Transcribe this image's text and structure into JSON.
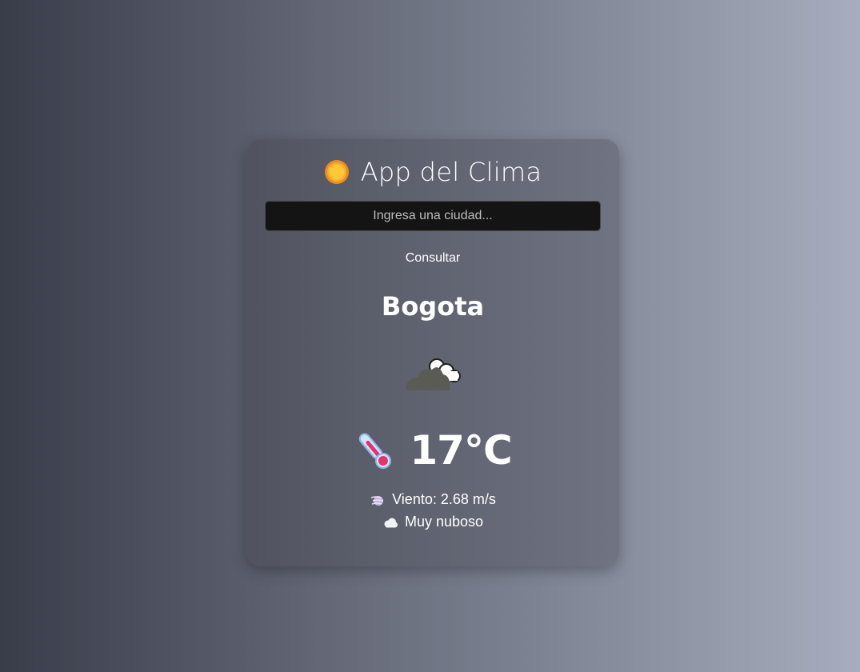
{
  "app": {
    "title": "App del Clima",
    "title_icon": "sun-icon"
  },
  "search": {
    "placeholder": "Ingresa una ciudad...",
    "value": "",
    "button_label": "Consultar"
  },
  "weather": {
    "city": "Bogota",
    "condition_icon": "cloud-icon",
    "temperature_icon": "thermometer-icon",
    "temperature": "17°C",
    "wind_icon": "wind-icon",
    "wind": "Viento: 2.68 m/s",
    "description_icon": "small-cloud-icon",
    "description": "Muy nuboso"
  },
  "colors": {
    "background_start": "#393d4a",
    "background_end": "#a7adbe",
    "card": "#5f6372",
    "input_bg": "#141414",
    "text": "#ffffff"
  }
}
